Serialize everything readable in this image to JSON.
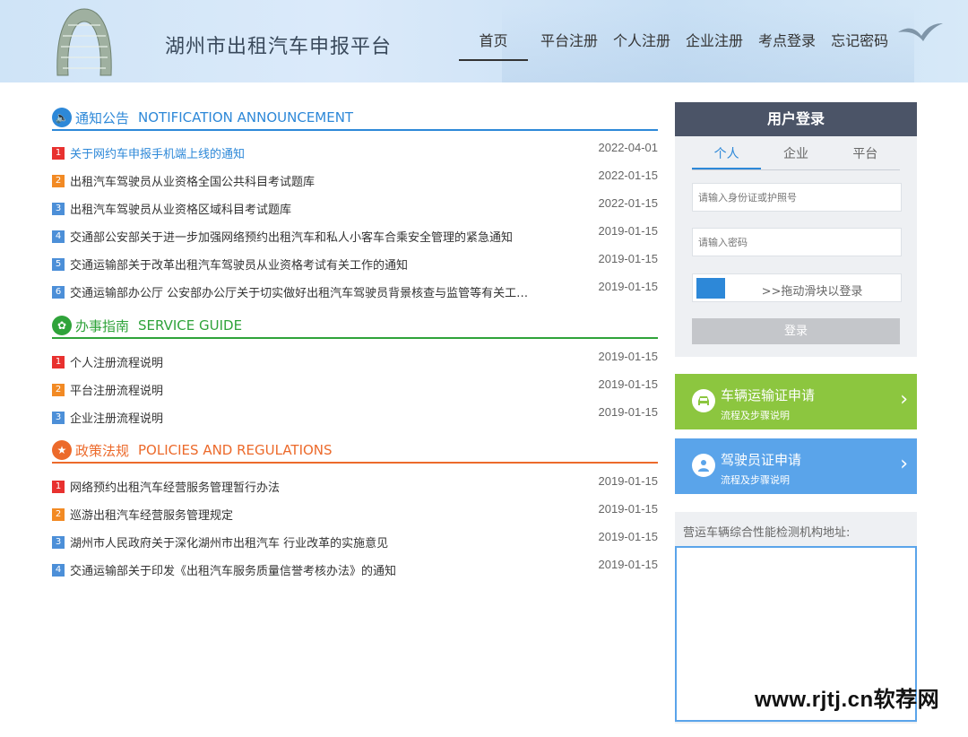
{
  "header": {
    "title": "湖州市出租汽车申报平台",
    "nav": [
      "首页",
      "平台注册",
      "个人注册",
      "企业注册",
      "考点登录",
      "忘记密码"
    ]
  },
  "notice": {
    "title": "通知公告",
    "title_en": "NOTIFICATION ANNOUNCEMENT",
    "items": [
      {
        "num": "1",
        "title": "关于网约车申报手机端上线的通知",
        "date": "2022-04-01"
      },
      {
        "num": "2",
        "title": "出租汽车驾驶员从业资格全国公共科目考试题库",
        "date": "2022-01-15"
      },
      {
        "num": "3",
        "title": "出租汽车驾驶员从业资格区域科目考试题库",
        "date": "2022-01-15"
      },
      {
        "num": "4",
        "title": "交通部公安部关于进一步加强网络预约出租汽车和私人小客车合乘安全管理的紧急通知",
        "date": "2019-01-15"
      },
      {
        "num": "5",
        "title": "交通运输部关于改革出租汽车驾驶员从业资格考试有关工作的通知",
        "date": "2019-01-15"
      },
      {
        "num": "6",
        "title": "交通运输部办公厅 公安部办公厅关于切实做好出租汽车驾驶员背景核查与监管等有关工…",
        "date": "2019-01-15"
      }
    ]
  },
  "guide": {
    "title": "办事指南",
    "title_en": "SERVICE GUIDE",
    "items": [
      {
        "num": "1",
        "title": "个人注册流程说明",
        "date": "2019-01-15"
      },
      {
        "num": "2",
        "title": "平台注册流程说明",
        "date": "2019-01-15"
      },
      {
        "num": "3",
        "title": "企业注册流程说明",
        "date": "2019-01-15"
      }
    ]
  },
  "policy": {
    "title": "政策法规",
    "title_en": "POLICIES AND REGULATIONS",
    "items": [
      {
        "num": "1",
        "title": "网络预约出租汽车经营服务管理暂行办法",
        "date": "2019-01-15"
      },
      {
        "num": "2",
        "title": "巡游出租汽车经营服务管理规定",
        "date": "2019-01-15"
      },
      {
        "num": "3",
        "title": "湖州市人民政府关于深化湖州市出租汽车 行业改革的实施意见",
        "date": "2019-01-15"
      },
      {
        "num": "4",
        "title": "交通运输部关于印发《出租汽车服务质量信誉考核办法》的通知",
        "date": "2019-01-15"
      }
    ]
  },
  "login": {
    "title": "用户登录",
    "tabs": [
      "个人",
      "企业",
      "平台"
    ],
    "id_placeholder": "请输入身份证或护照号",
    "pwd_placeholder": "请输入密码",
    "slider_text": ">>拖动滑块以登录",
    "button": "登录"
  },
  "cards": [
    {
      "title": "车辆运输证申请",
      "sub": "流程及步骤说明"
    },
    {
      "title": "驾驶员证申请",
      "sub": "流程及步骤说明"
    }
  ],
  "inspect": {
    "title": "营运车辆综合性能检测机构地址:"
  },
  "watermark": "www.rjtj.cn软荐网",
  "colors": {
    "blue": "#2d88d8",
    "green": "#2fa33a",
    "orange": "#ec6a2b",
    "login_head": "#4b5467"
  }
}
